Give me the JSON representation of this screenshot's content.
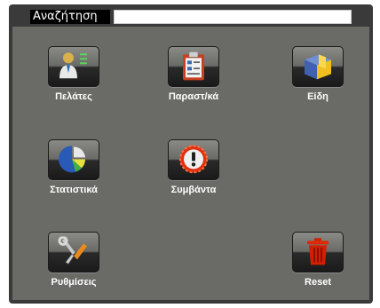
{
  "search": {
    "label": "Αναζήτηση",
    "value": ""
  },
  "tiles": {
    "customers": {
      "label": "Πελάτες",
      "icon": "customer-icon"
    },
    "documents": {
      "label": "Παραστ/κά",
      "icon": "clipboard-icon"
    },
    "items": {
      "label": "Είδη",
      "icon": "box-icon"
    },
    "statistics": {
      "label": "Στατιστικά",
      "icon": "pie-chart-icon"
    },
    "events": {
      "label": "Συμβάντα",
      "icon": "alert-icon"
    },
    "settings": {
      "label": "Ρυθμίσεις",
      "icon": "tools-icon"
    },
    "reset": {
      "label": "Reset",
      "icon": "trash-icon"
    }
  },
  "colors": {
    "panel": "#6a6a66",
    "frame": "#3a3a3a",
    "accent_red": "#cc2200"
  }
}
